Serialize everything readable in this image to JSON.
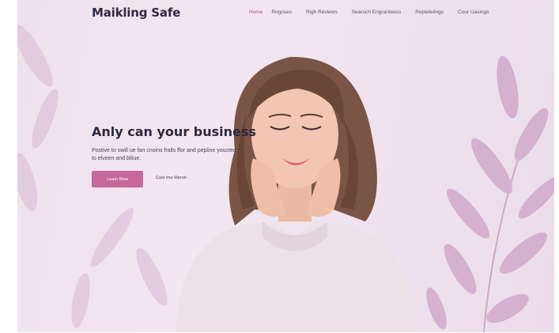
{
  "brand": {
    "name": "Maikling Safe"
  },
  "nav": {
    "links": [
      "Home",
      "Rogoses",
      "Righ Reviews",
      "Searuch Engranteess",
      "Reptelelings",
      "Cour Uasings"
    ]
  },
  "hero": {
    "title": "Anly can your business",
    "subtitle": "Postive to swill ue fan cnoins fralls ffor and pepline youcted to elveen and blilue.",
    "primary_button": "Learn Now",
    "secondary_link": "Cast ime Meron"
  },
  "colors": {
    "accent": "#c7679a",
    "active_nav": "#c04a7d",
    "text_dark": "#2c2840",
    "background": "#f0e3ee"
  }
}
